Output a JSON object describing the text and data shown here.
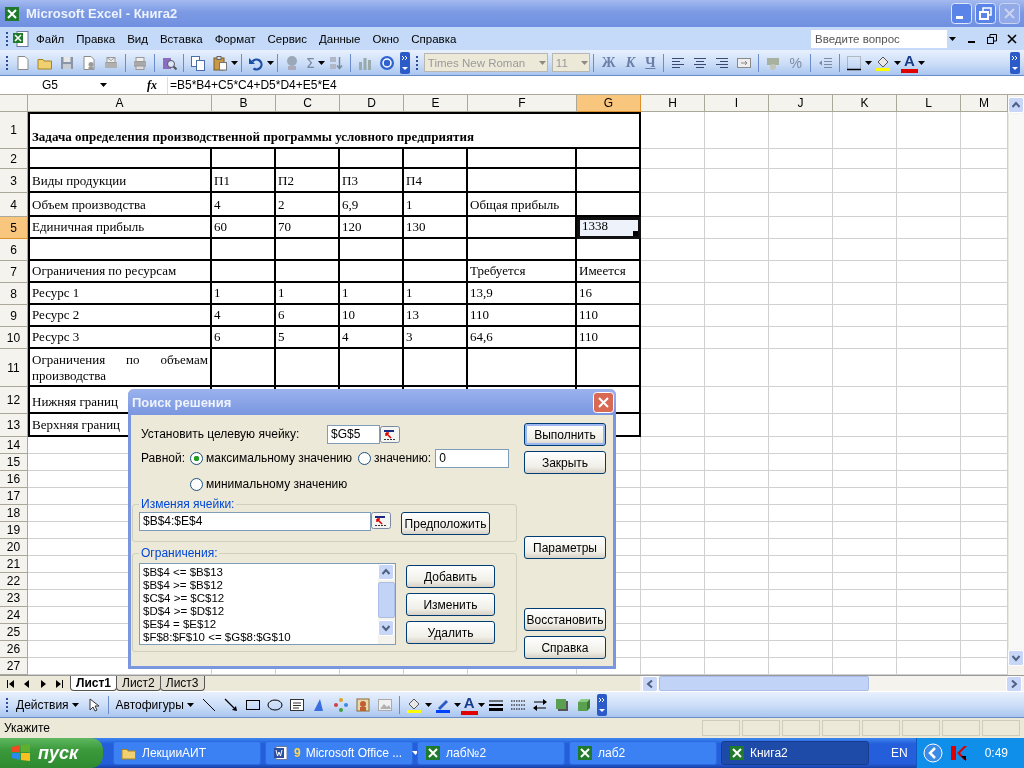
{
  "window": {
    "title": "Microsoft Excel - Книга2"
  },
  "menu": [
    "Файл",
    "Правка",
    "Вид",
    "Вставка",
    "Формат",
    "Сервис",
    "Данные",
    "Окно",
    "Справка"
  ],
  "help_box": {
    "placeholder": "Введите вопрос"
  },
  "toolbar": {
    "sum_button": "Σ",
    "font": "Times New Roman",
    "font_size": "11",
    "format_buttons": [
      "Ж",
      "К",
      "Ч"
    ],
    "percent_button": "%",
    "font_color_button": "A"
  },
  "formula_bar": {
    "name_box": "G5",
    "function_label": "fx",
    "formula": "=B5*B4+C5*C4+D5*D4+E5*E4"
  },
  "sheet": {
    "columns": [
      "A",
      "B",
      "C",
      "D",
      "E",
      "F",
      "G",
      "H",
      "I",
      "J",
      "K",
      "L",
      "M"
    ],
    "rows": [
      {
        "number": "1",
        "cells": [
          {
            "text": "Задача определения производственной программы условного предприятия",
            "selected": false
          }
        ]
      },
      {
        "number": "2"
      },
      {
        "number": "3",
        "cells": [
          {
            "text": "Виды продукции",
            "selected": false
          },
          {
            "text": "П1",
            "selected": false
          },
          {
            "text": "П2",
            "selected": false
          },
          {
            "text": "П3",
            "selected": false
          },
          {
            "text": "П4",
            "selected": false
          }
        ]
      },
      {
        "number": "4",
        "cells": [
          {
            "text": "Объем производства",
            "selected": false
          },
          {
            "text": "4",
            "selected": false
          },
          {
            "text": "2",
            "selected": false
          },
          {
            "text": "6,9",
            "selected": false
          },
          {
            "text": "1",
            "selected": false
          },
          {
            "text": "Общая прибыль",
            "selected": false
          }
        ]
      },
      {
        "number": "5",
        "cells": [
          {
            "text": "Единичная прибыль",
            "selected": false
          },
          {
            "text": "60",
            "selected": false
          },
          {
            "text": "70",
            "selected": false
          },
          {
            "text": "120",
            "selected": false
          },
          {
            "text": "130",
            "selected": false
          },
          null,
          {
            "text": "1338",
            "selected": true
          }
        ]
      },
      {
        "number": "6"
      },
      {
        "number": "7",
        "cells": [
          {
            "text": "Ограничения по ресурсам",
            "selected": false
          },
          null,
          null,
          null,
          null,
          {
            "text": "Требуется",
            "selected": false
          },
          {
            "text": "Имеется",
            "selected": false
          }
        ]
      },
      {
        "number": "8",
        "cells": [
          {
            "text": "Ресурс 1",
            "selected": false
          },
          {
            "text": "1",
            "selected": false
          },
          {
            "text": "1",
            "selected": false
          },
          {
            "text": "1",
            "selected": false
          },
          {
            "text": "1",
            "selected": false
          },
          {
            "text": "13,9",
            "selected": false
          },
          {
            "text": "16",
            "selected": false
          }
        ]
      },
      {
        "number": "9",
        "cells": [
          {
            "text": "Ресурс 2",
            "selected": false
          },
          {
            "text": "4",
            "selected": false
          },
          {
            "text": "6",
            "selected": false
          },
          {
            "text": "10",
            "selected": false
          },
          {
            "text": "13",
            "selected": false
          },
          {
            "text": "110",
            "selected": false
          },
          {
            "text": "110",
            "selected": false
          }
        ]
      },
      {
        "number": "10",
        "cells": [
          {
            "text": "Ресурс 3",
            "selected": false
          },
          {
            "text": "6",
            "selected": false
          },
          {
            "text": "5",
            "selected": false
          },
          {
            "text": "4",
            "selected": false
          },
          {
            "text": "3",
            "selected": false
          },
          {
            "text": "64,6",
            "selected": false
          },
          {
            "text": "110",
            "selected": false
          }
        ]
      },
      {
        "number": "11",
        "cells": [
          {
            "text": "Ограничения по объемам производства",
            "selected": false
          }
        ]
      },
      {
        "number": "12",
        "cells": [
          {
            "text": "Нижняя границ",
            "selected": false
          }
        ]
      },
      {
        "number": "13",
        "cells": [
          {
            "text": "Верхняя границ",
            "selected": false
          }
        ]
      },
      {
        "number": "14"
      },
      {
        "number": "15"
      },
      {
        "number": "16"
      },
      {
        "number": "17"
      },
      {
        "number": "18"
      },
      {
        "number": "19"
      },
      {
        "number": "20"
      },
      {
        "number": "21"
      },
      {
        "number": "22"
      },
      {
        "number": "23"
      },
      {
        "number": "24"
      },
      {
        "number": "25"
      },
      {
        "number": "26"
      },
      {
        "number": "27"
      }
    ]
  },
  "sheet_tabs": [
    {
      "label": "Лист1",
      "selected": true
    },
    {
      "label": "Лист2",
      "selected": false
    },
    {
      "label": "Лист3",
      "selected": false
    }
  ],
  "drawing_toolbar": {
    "actions_menu": "Действия",
    "autoshapes_menu": "Автофигуры",
    "font_color_button": "A"
  },
  "status_bar": {
    "text": "Укажите"
  },
  "taskbar": {
    "start_button": "пуск",
    "tasks": [
      {
        "label": "ЛекцииАИТ",
        "kind": "folder",
        "selected": false
      },
      {
        "label": "Microsoft Office ...",
        "count": "9",
        "kind": "word",
        "selected": false
      },
      {
        "label": "лаб№2",
        "kind": "excel",
        "selected": false
      },
      {
        "label": "лаб2",
        "kind": "excel",
        "selected": false
      },
      {
        "label": "Книга2",
        "kind": "excel",
        "selected": true
      }
    ],
    "language": "EN",
    "clock": "0:49"
  },
  "dialog": {
    "title": "Поиск решения",
    "target_label": "Установить целевую ячейку:",
    "target_value": "$G$5",
    "equal_label": "Равной:",
    "options": [
      {
        "label": "максимальному значению",
        "selected": true
      },
      {
        "label": "значению:",
        "selected": false
      },
      {
        "label": "минимальному значению",
        "selected": false
      }
    ],
    "value_field": "0",
    "changing_label": "Изменяя ячейки:",
    "changing_value": "$B$4:$E$4",
    "guess_button": "Предположить",
    "constraints_label": "Ограничения:",
    "constraints": [
      "$B$4 <= $B$13",
      "$B$4 >= $B$12",
      "$C$4 >= $C$12",
      "$D$4 >= $D$12",
      "$E$4 = $E$12",
      "$F$8:$F$10 <= $G$8:$G$10"
    ],
    "constraint_buttons": [
      "Добавить",
      "Изменить",
      "Удалить"
    ],
    "buttons": [
      {
        "label": "Выполнить",
        "default": true
      },
      {
        "label": "Закрыть",
        "default": false
      },
      {
        "label": "Параметры",
        "default": false
      },
      {
        "label": "Восстановить",
        "default": false
      },
      {
        "label": "Справка",
        "default": false
      }
    ]
  }
}
